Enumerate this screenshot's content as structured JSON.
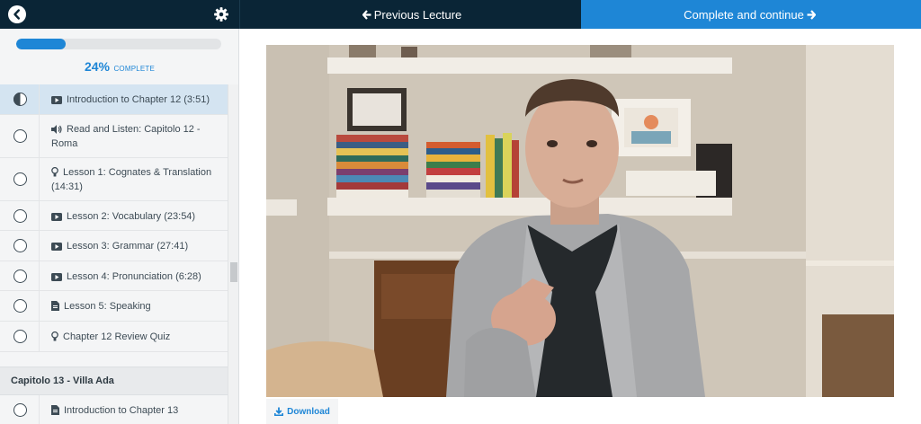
{
  "topbar": {
    "back_icon": "chevron-left-icon",
    "settings_icon": "gear-icon",
    "previous_label": "Previous Lecture",
    "next_label": "Complete and continue"
  },
  "progress": {
    "percent": 24,
    "percent_text": "24%",
    "label": "COMPLETE"
  },
  "curriculum": {
    "items": [
      {
        "title": "Introduction to Chapter 12 (3:51)",
        "icon": "video-icon",
        "status": "in-progress",
        "active": true
      },
      {
        "title": "Read and Listen: Capitolo 12 - Roma",
        "icon": "audio-icon",
        "status": "incomplete",
        "active": false
      },
      {
        "title": "Lesson 1: Cognates & Translation (14:31)",
        "icon": "lightbulb-icon",
        "status": "incomplete",
        "active": false
      },
      {
        "title": "Lesson 2: Vocabulary (23:54)",
        "icon": "video-icon",
        "status": "incomplete",
        "active": false
      },
      {
        "title": "Lesson 3: Grammar (27:41)",
        "icon": "video-icon",
        "status": "incomplete",
        "active": false
      },
      {
        "title": "Lesson 4: Pronunciation (6:28)",
        "icon": "video-icon",
        "status": "incomplete",
        "active": false
      },
      {
        "title": "Lesson 5: Speaking",
        "icon": "document-icon",
        "status": "incomplete",
        "active": false
      },
      {
        "title": "Chapter 12 Review Quiz",
        "icon": "lightbulb-icon",
        "status": "incomplete",
        "active": false
      }
    ],
    "next_section": {
      "title": "Capitolo 13 - Villa Ada",
      "items": [
        {
          "title": "Introduction to Chapter 13",
          "icon": "document-icon",
          "status": "incomplete"
        }
      ]
    }
  },
  "main": {
    "download_label": "Download",
    "download_icon": "download-icon",
    "video_subject": "video-frame"
  },
  "colors": {
    "nav_dark": "#0a2536",
    "accent": "#1e86d6",
    "sidebar_bg": "#f4f5f6",
    "active_row": "#d4e4f1"
  }
}
